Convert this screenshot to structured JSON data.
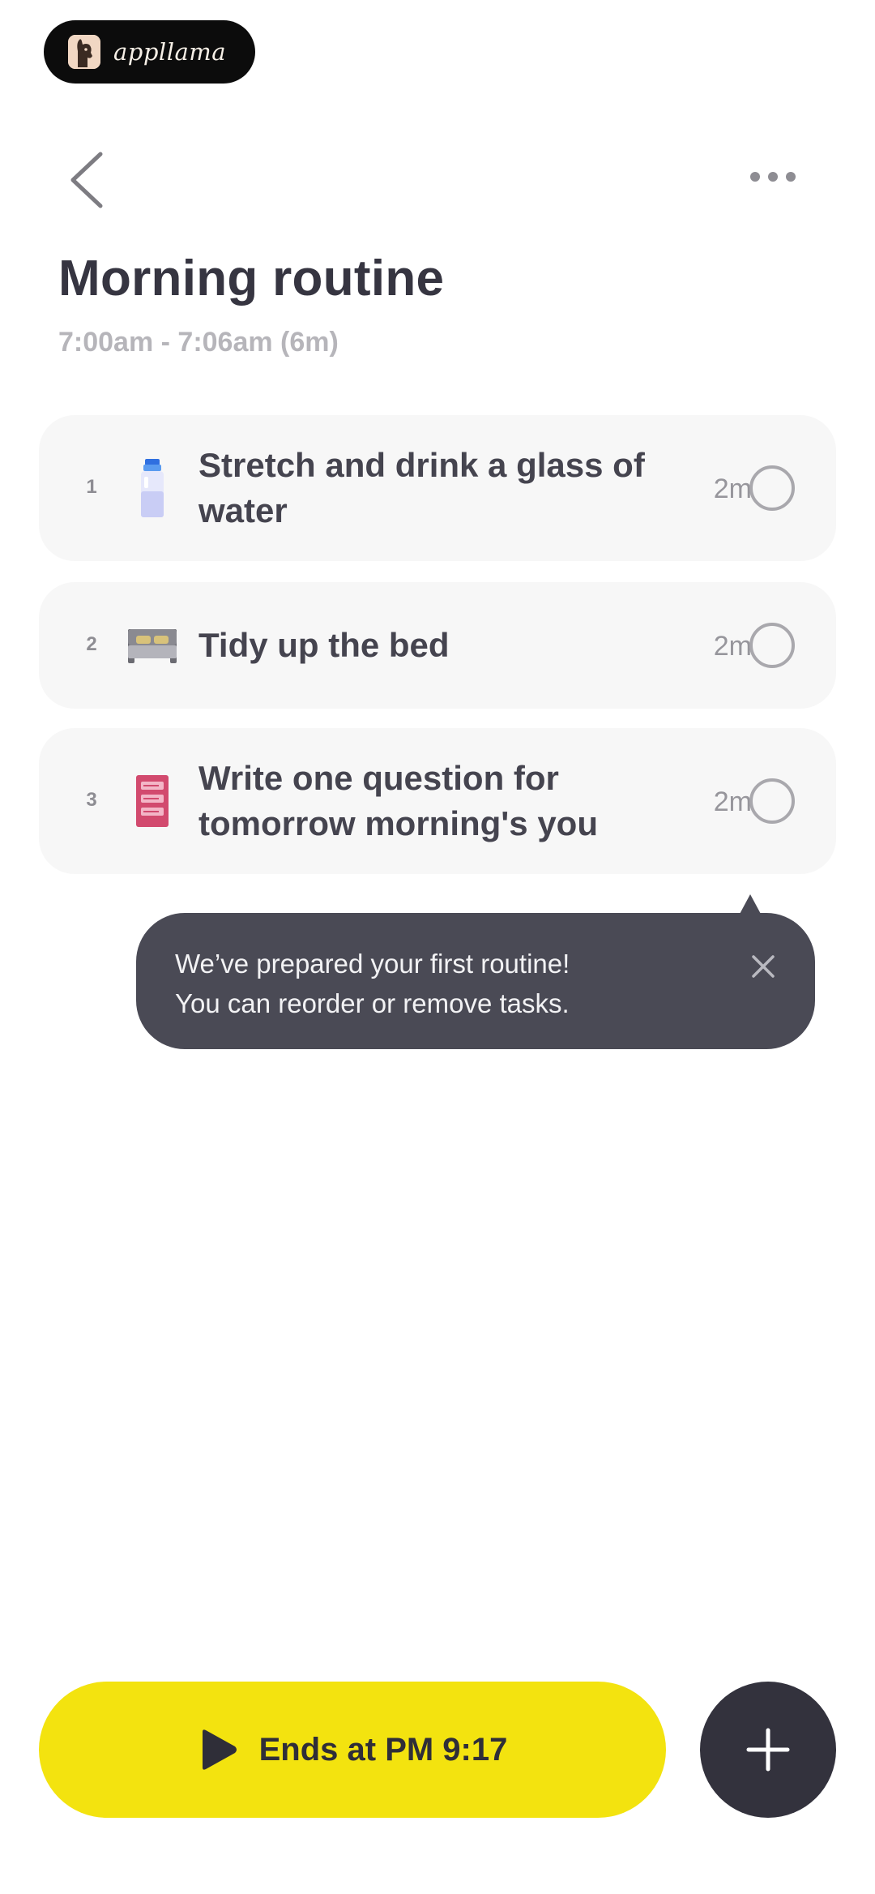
{
  "brand": {
    "name": "appllama"
  },
  "header": {
    "back_icon": "chevron-left-icon",
    "more_icon": "more-horizontal-icon"
  },
  "routine": {
    "title": "Morning routine",
    "time_range": "7:00am - 7:06am (6m)"
  },
  "tasks": [
    {
      "number": "1",
      "icon": "water-bottle-icon",
      "title": "Stretch and drink a glass of water",
      "duration": "2m",
      "done": false
    },
    {
      "number": "2",
      "icon": "bed-icon",
      "title": "Tidy up the bed",
      "duration": "2m",
      "done": false
    },
    {
      "number": "3",
      "icon": "notes-icon",
      "title": "Write one question for tomorrow morning's you",
      "duration": "2m",
      "done": false
    }
  ],
  "tooltip": {
    "line1": "We’ve prepared your first routine!",
    "line2": "You can reorder or remove tasks.",
    "close_icon": "close-icon"
  },
  "bottom": {
    "start_label": "Ends at PM 9:17",
    "play_icon": "play-icon",
    "add_icon": "plus-icon"
  },
  "colors": {
    "accent_yellow": "#f3e30f",
    "dark": "#33323d",
    "tooltip_bg": "#4a4a55",
    "card_bg": "#f7f7f7"
  }
}
